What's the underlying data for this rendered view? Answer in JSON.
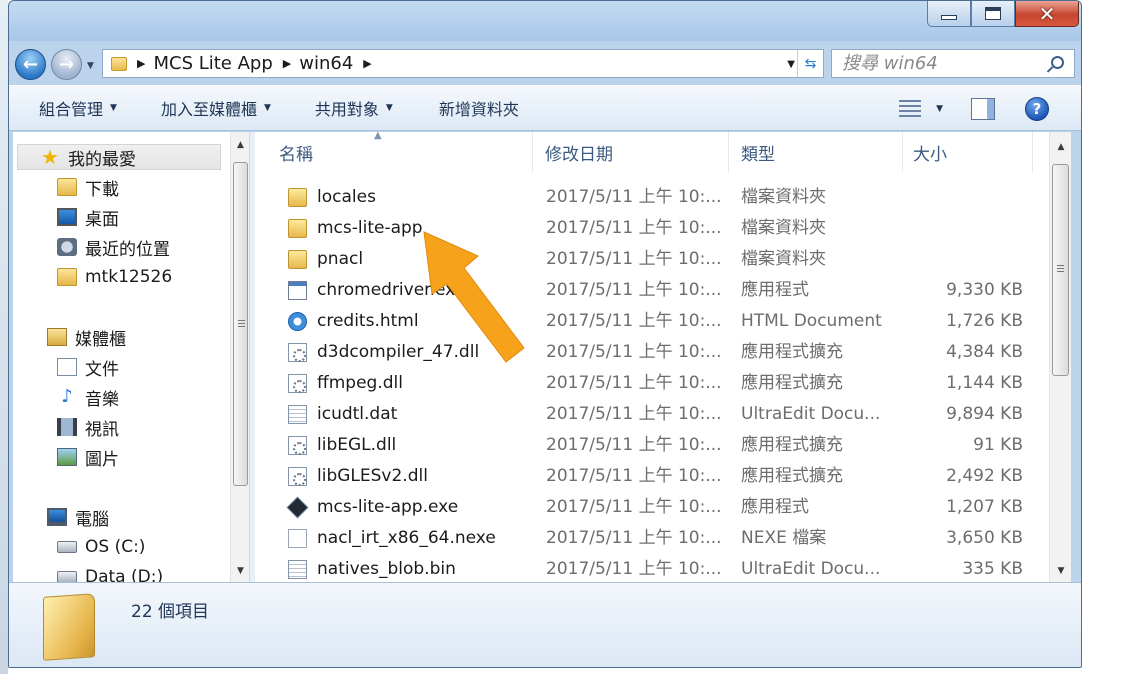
{
  "address": {
    "crumbs": [
      "MCS Lite App",
      "win64"
    ]
  },
  "search": {
    "placeholder": "搜尋 win64"
  },
  "toolbar": {
    "organize": "組合管理",
    "add_to_library": "加入至媒體櫃",
    "share_with": "共用對象",
    "new_folder": "新增資料夾"
  },
  "nav": {
    "favorites": "我的最愛",
    "downloads": "下載",
    "desktop": "桌面",
    "recent": "最近的位置",
    "user": "mtk12526",
    "libraries": "媒體櫃",
    "documents": "文件",
    "music": "音樂",
    "videos": "視訊",
    "pictures": "圖片",
    "computer": "電腦",
    "drive_c": "OS (C:)",
    "drive_d": "Data (D:)"
  },
  "columns": {
    "name": "名稱",
    "date": "修改日期",
    "type": "類型",
    "size": "大小"
  },
  "files": [
    {
      "name": "locales",
      "date": "2017/5/11 上午 10:...",
      "type": "檔案資料夾",
      "size": "",
      "icon": "folder-icon"
    },
    {
      "name": "mcs-lite-app",
      "date": "2017/5/11 上午 10:...",
      "type": "檔案資料夾",
      "size": "",
      "icon": "folder-icon"
    },
    {
      "name": "pnacl",
      "date": "2017/5/11 上午 10:...",
      "type": "檔案資料夾",
      "size": "",
      "icon": "folder-icon"
    },
    {
      "name": "chromedriver.exe",
      "date": "2017/5/11 上午 10:...",
      "type": "應用程式",
      "size": "9,330 KB",
      "icon": "exe-icon"
    },
    {
      "name": "credits.html",
      "date": "2017/5/11 上午 10:...",
      "type": "HTML Document",
      "size": "1,726 KB",
      "icon": "html-icon"
    },
    {
      "name": "d3dcompiler_47.dll",
      "date": "2017/5/11 上午 10:...",
      "type": "應用程式擴充",
      "size": "4,384 KB",
      "icon": "dll-icon"
    },
    {
      "name": "ffmpeg.dll",
      "date": "2017/5/11 上午 10:...",
      "type": "應用程式擴充",
      "size": "1,144 KB",
      "icon": "dll-icon"
    },
    {
      "name": "icudtl.dat",
      "date": "2017/5/11 上午 10:...",
      "type": "UltraEdit Docu...",
      "size": "9,894 KB",
      "icon": "dat-icon"
    },
    {
      "name": "libEGL.dll",
      "date": "2017/5/11 上午 10:...",
      "type": "應用程式擴充",
      "size": "91 KB",
      "icon": "dll-icon"
    },
    {
      "name": "libGLESv2.dll",
      "date": "2017/5/11 上午 10:...",
      "type": "應用程式擴充",
      "size": "2,492 KB",
      "icon": "dll-icon"
    },
    {
      "name": "mcs-lite-app.exe",
      "date": "2017/5/11 上午 10:...",
      "type": "應用程式",
      "size": "1,207 KB",
      "icon": "app-icon"
    },
    {
      "name": "nacl_irt_x86_64.nexe",
      "date": "2017/5/11 上午 10:...",
      "type": "NEXE 檔案",
      "size": "3,650 KB",
      "icon": "blank-file-icon"
    },
    {
      "name": "natives_blob.bin",
      "date": "2017/5/11 上午 10:...",
      "type": "UltraEdit Docu...",
      "size": "335 KB",
      "icon": "dat-icon"
    }
  ],
  "status": {
    "item_count": "22 個項目"
  },
  "colors": {
    "arrow": "#f7a21b",
    "window_frame": "#bcd3ec",
    "close_button": "#c74632"
  }
}
